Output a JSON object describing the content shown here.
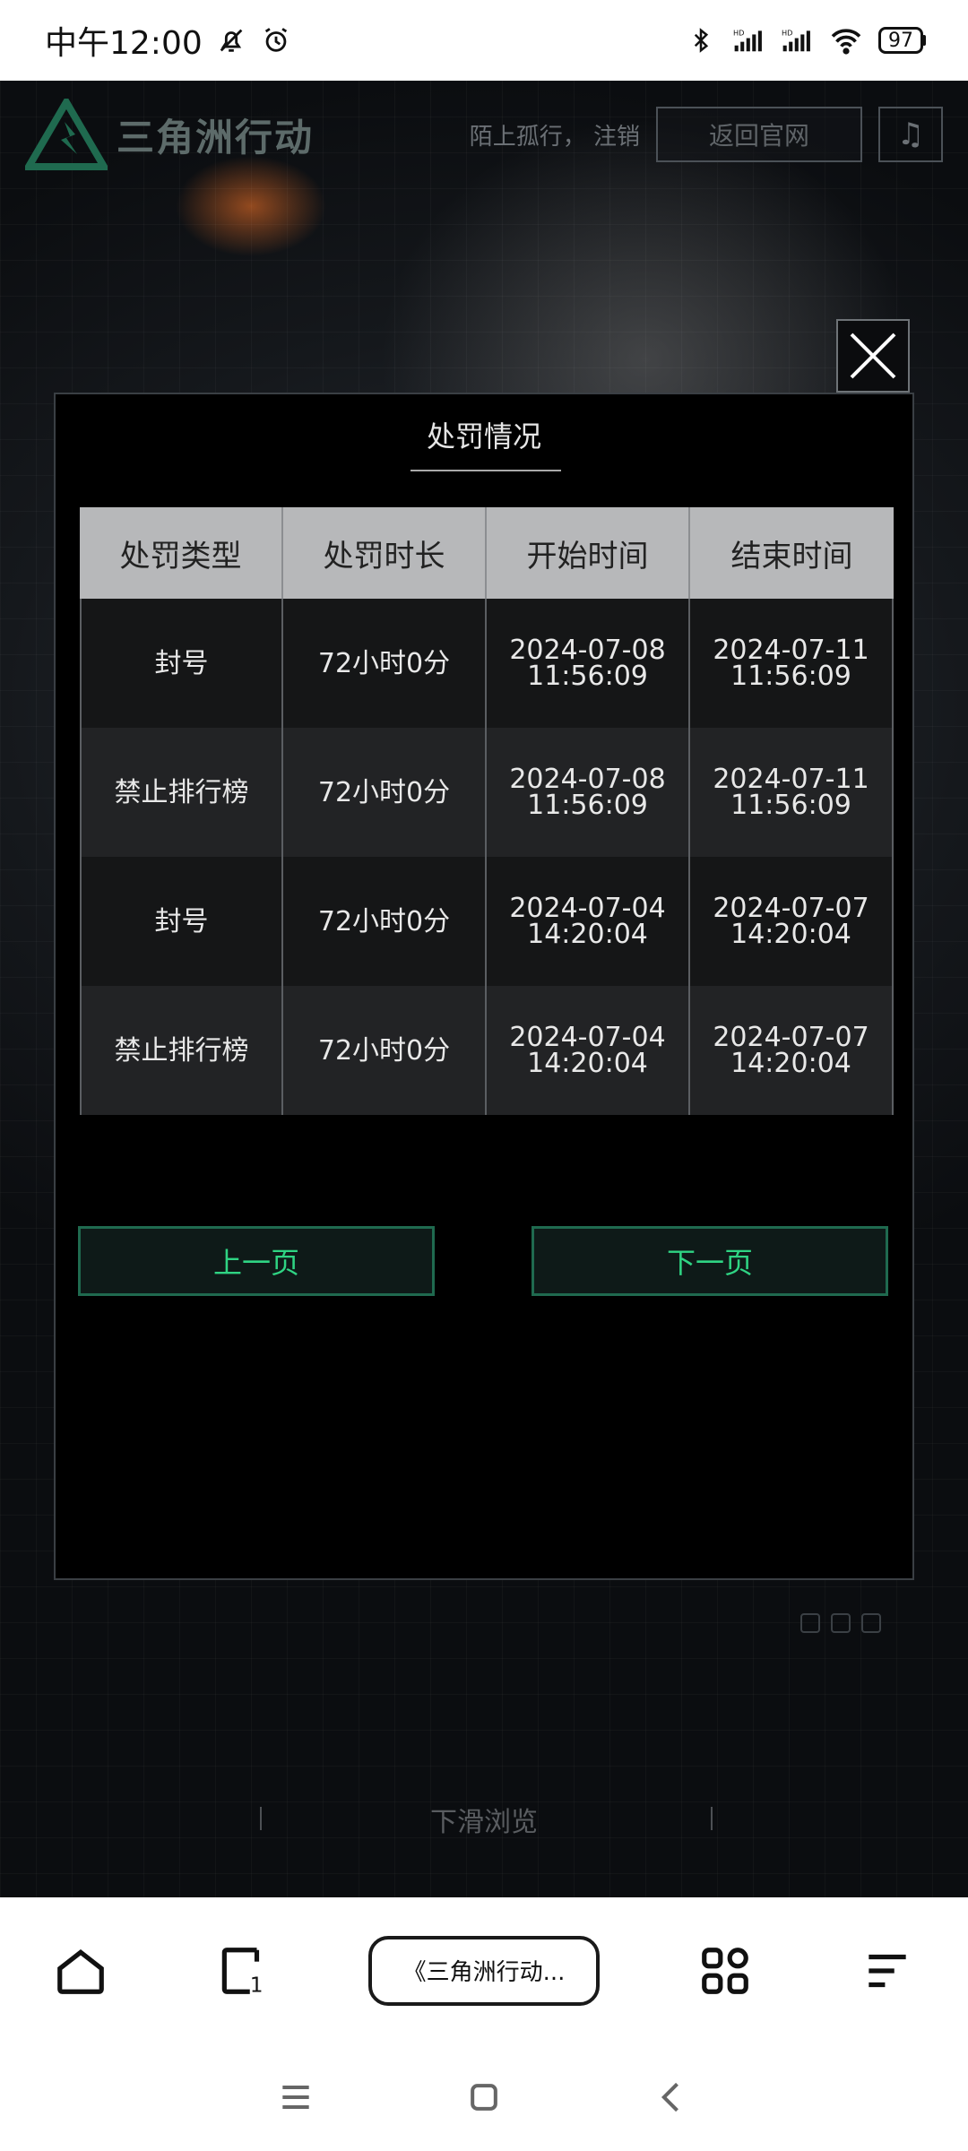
{
  "status_bar": {
    "time": "中午12:00",
    "battery": "97",
    "icons": [
      "bell-off-icon",
      "alarm-icon",
      "bluetooth-icon",
      "signal-hd-icon",
      "signal-hd-icon",
      "wifi-icon"
    ]
  },
  "site_header": {
    "logo_text": "三角洲行动",
    "account_text": "陌上孤行，  注销",
    "back_button": "返回官网",
    "music_icon": "music-note-icon"
  },
  "modal": {
    "title": "处罚情况",
    "columns": [
      "处罚类型",
      "处罚时长",
      "开始时间",
      "结束时间"
    ],
    "rows": [
      {
        "type": "封号",
        "duration": "72小时0分",
        "start": "2024-07-08 11:56:09",
        "end": "2024-07-11 11:56:09"
      },
      {
        "type": "禁止排行榜",
        "duration": "72小时0分",
        "start": "2024-07-08 11:56:09",
        "end": "2024-07-11 11:56:09"
      },
      {
        "type": "封号",
        "duration": "72小时0分",
        "start": "2024-07-04 14:20:04",
        "end": "2024-07-07 14:20:04"
      },
      {
        "type": "禁止排行榜",
        "duration": "72小时0分",
        "start": "2024-07-04 14:20:04",
        "end": "2024-07-07 14:20:04"
      }
    ],
    "prev_button": "上一页",
    "next_button": "下一页"
  },
  "scroll_hint": "下滑浏览",
  "browser_bar": {
    "tab_title": "《三角洲行动...",
    "icons": [
      "home-icon",
      "tabs-icon",
      "apps-icon",
      "menu-icon"
    ]
  },
  "colors": {
    "accent_green": "#2fd483",
    "button_border": "#1f6a4f",
    "header_row": "#b7b8ba"
  }
}
